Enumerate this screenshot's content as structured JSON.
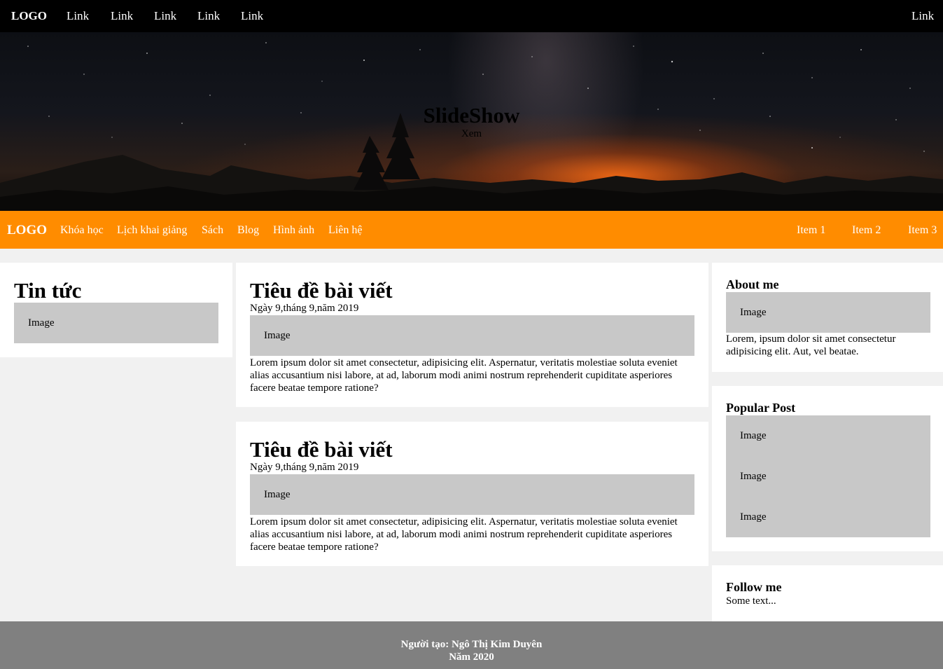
{
  "topbar": {
    "logo": "LOGO",
    "links": [
      "Link",
      "Link",
      "Link",
      "Link",
      "Link"
    ],
    "right_link": "Link"
  },
  "hero": {
    "title": "SlideShow",
    "subtitle": "Xem"
  },
  "navbar": {
    "logo": "LOGO",
    "items": [
      "Khóa học",
      "Lịch khai giảng",
      "Sách",
      "Blog",
      "Hình ảnh",
      "Liên hệ"
    ],
    "right_items": [
      "Item 1",
      "Item 2",
      "Item 3"
    ]
  },
  "left": {
    "title": "Tin tức",
    "image_label": "Image"
  },
  "posts": [
    {
      "title": "Tiêu đề bài viết",
      "date": "Ngày 9,tháng 9,năm 2019",
      "image_label": "Image",
      "body": "Lorem ipsum dolor sit amet consectetur, adipisicing elit. Aspernatur, veritatis molestiae soluta eveniet alias accusantium nisi labore, at ad, laborum modi animi nostrum reprehenderit cupiditate asperiores facere beatae tempore ratione?"
    },
    {
      "title": "Tiêu đề bài viết",
      "date": "Ngày 9,tháng 9,năm 2019",
      "image_label": "Image",
      "body": "Lorem ipsum dolor sit amet consectetur, adipisicing elit. Aspernatur, veritatis molestiae soluta eveniet alias accusantium nisi labore, at ad, laborum modi animi nostrum reprehenderit cupiditate asperiores facere beatae tempore ratione?"
    }
  ],
  "sidebar": {
    "about": {
      "title": "About me",
      "image_label": "Image",
      "text": "Lorem, ipsum dolor sit amet consectetur adipisicing elit. Aut, vel beatae."
    },
    "popular": {
      "title": "Popular Post",
      "images": [
        "Image",
        "Image",
        "Image"
      ]
    },
    "follow": {
      "title": "Follow me",
      "text": "Some text..."
    }
  },
  "footer": {
    "author": "Người tạo: Ngô Thị Kim Duyên",
    "year": "Năm 2020"
  },
  "colors": {
    "topbar_bg": "#000000",
    "navbar_bg": "#ff8c00",
    "page_bg": "#f1f1f1",
    "image_placeholder": "#c8c8c8",
    "footer_bg": "#808080"
  }
}
